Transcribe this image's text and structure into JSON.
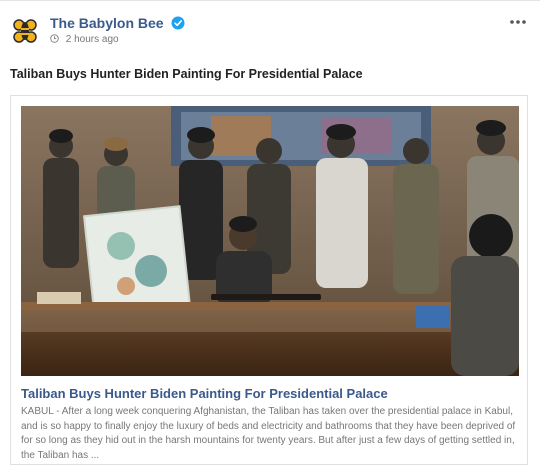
{
  "post": {
    "page_name": "The Babylon Bee",
    "timestamp": "2 hours ago",
    "text": "Taliban Buys Hunter Biden Painting For Presidential Palace",
    "more_icon": "ellipsis-icon",
    "verified_icon": "verified-check-icon",
    "brand_color": "#3a5a8c",
    "verified_color": "#1da1f2"
  },
  "link": {
    "title": "Taliban Buys Hunter Biden Painting For Presidential Palace",
    "description": "KABUL - After a long week conquering Afghanistan, the Taliban has taken over the presidential palace in Kabul, and is so happy to finally enjoy the luxury of beds and electricity and bathrooms that they have been deprived of for so long as they hid out in the harsh mountains for twenty years. But after just a few days of getting settled in, the Taliban has ..."
  }
}
